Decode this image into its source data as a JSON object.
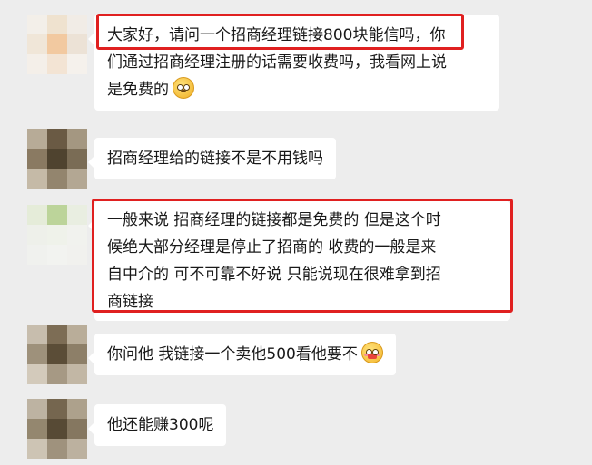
{
  "messages": [
    {
      "lines": [
        "大家好，请问一个招商经理链接800块能信吗，你",
        "们通过招商经理注册的话需要收费吗，我看网上说",
        "是免费的"
      ],
      "emoji": "worried-face"
    },
    {
      "lines": [
        "招商经理给的链接不是不用钱吗"
      ]
    },
    {
      "lines": [
        "一般来说 招商经理的链接都是免费的 但是这个时",
        "候绝大部分经理是停止了招商的  收费的一般是来",
        "自中介的  可不可靠不好说  只能说现在很难拿到招",
        "商链接"
      ]
    },
    {
      "lines": [
        "你问他 我链接一个卖他500看他要不"
      ],
      "emoji": "blushing-face"
    },
    {
      "lines": [
        "他还能赚300呢"
      ]
    }
  ],
  "colors": {
    "background": "#ededed",
    "bubble": "#ffffff",
    "highlight_box": "#e02020"
  }
}
